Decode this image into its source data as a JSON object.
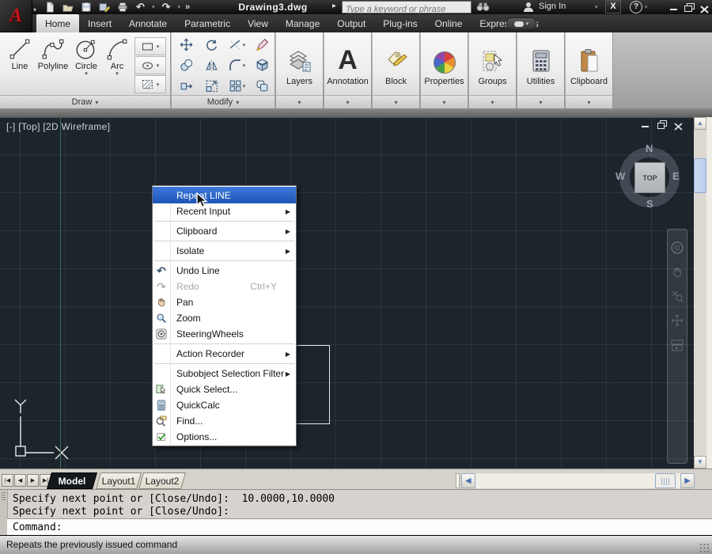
{
  "titlebar": {
    "title": "Drawing3.dwg",
    "search_placeholder": "Type a keyword or phrase",
    "sign_in_label": "Sign In"
  },
  "ribbon_tabs": [
    "Home",
    "Insert",
    "Annotate",
    "Parametric",
    "View",
    "Manage",
    "Output",
    "Plug-ins",
    "Online",
    "Express Tools"
  ],
  "ribbon": {
    "draw_panel": {
      "label": "Draw",
      "line": "Line",
      "polyline": "Polyline",
      "circle": "Circle",
      "arc": "Arc"
    },
    "modify_panel": {
      "label": "Modify"
    },
    "collapsed_panels": [
      "Layers",
      "Annotation",
      "Block",
      "Properties",
      "Groups",
      "Utilities",
      "Clipboard"
    ]
  },
  "viewport": {
    "header": "[-] [Top] [2D Wireframe]",
    "viewcube": {
      "north": "N",
      "south": "S",
      "east": "E",
      "west": "W",
      "top": "TOP"
    }
  },
  "context_menu": {
    "repeat": "Repeat LINE",
    "recent_input": "Recent Input",
    "clipboard": "Clipboard",
    "isolate": "Isolate",
    "undo": "Undo Line",
    "redo": "Redo",
    "redo_shortcut": "Ctrl+Y",
    "pan": "Pan",
    "zoom": "Zoom",
    "steering": "SteeringWheels",
    "action_recorder": "Action Recorder",
    "subobject": "Subobject Selection Filter",
    "quick_select": "Quick Select...",
    "quickcalc": "QuickCalc",
    "find": "Find...",
    "options": "Options..."
  },
  "layout_tabs": {
    "model": "Model",
    "layout1": "Layout1",
    "layout2": "Layout2"
  },
  "command_window": {
    "line1": "Specify next point or [Close/Undo]:  10.0000,10.0000",
    "line2": "Specify next point or [Close/Undo]:",
    "prompt": "Command:"
  },
  "status_message": "Repeats the previously issued command",
  "icons": {
    "caret_down": "▾",
    "flyout": "▸",
    "expand": "»",
    "submenu_arrow": "▶",
    "scroll_up": "▲",
    "scroll_down": "▼",
    "scroll_left": "◀",
    "scroll_right": "▶",
    "tab_first": "|◀",
    "tab_prev": "◀",
    "tab_next": "▶",
    "tab_last": "▶|",
    "undo": "↶",
    "redo": "↷",
    "help": "?",
    "exchange": "X",
    "annotation_glyph": "A",
    "logo_glyph": "A"
  },
  "colors": {
    "canvas_bg": "#1c242c",
    "menu_highlight": "#2a64cc",
    "accent_blue": "#5a7fb4"
  }
}
